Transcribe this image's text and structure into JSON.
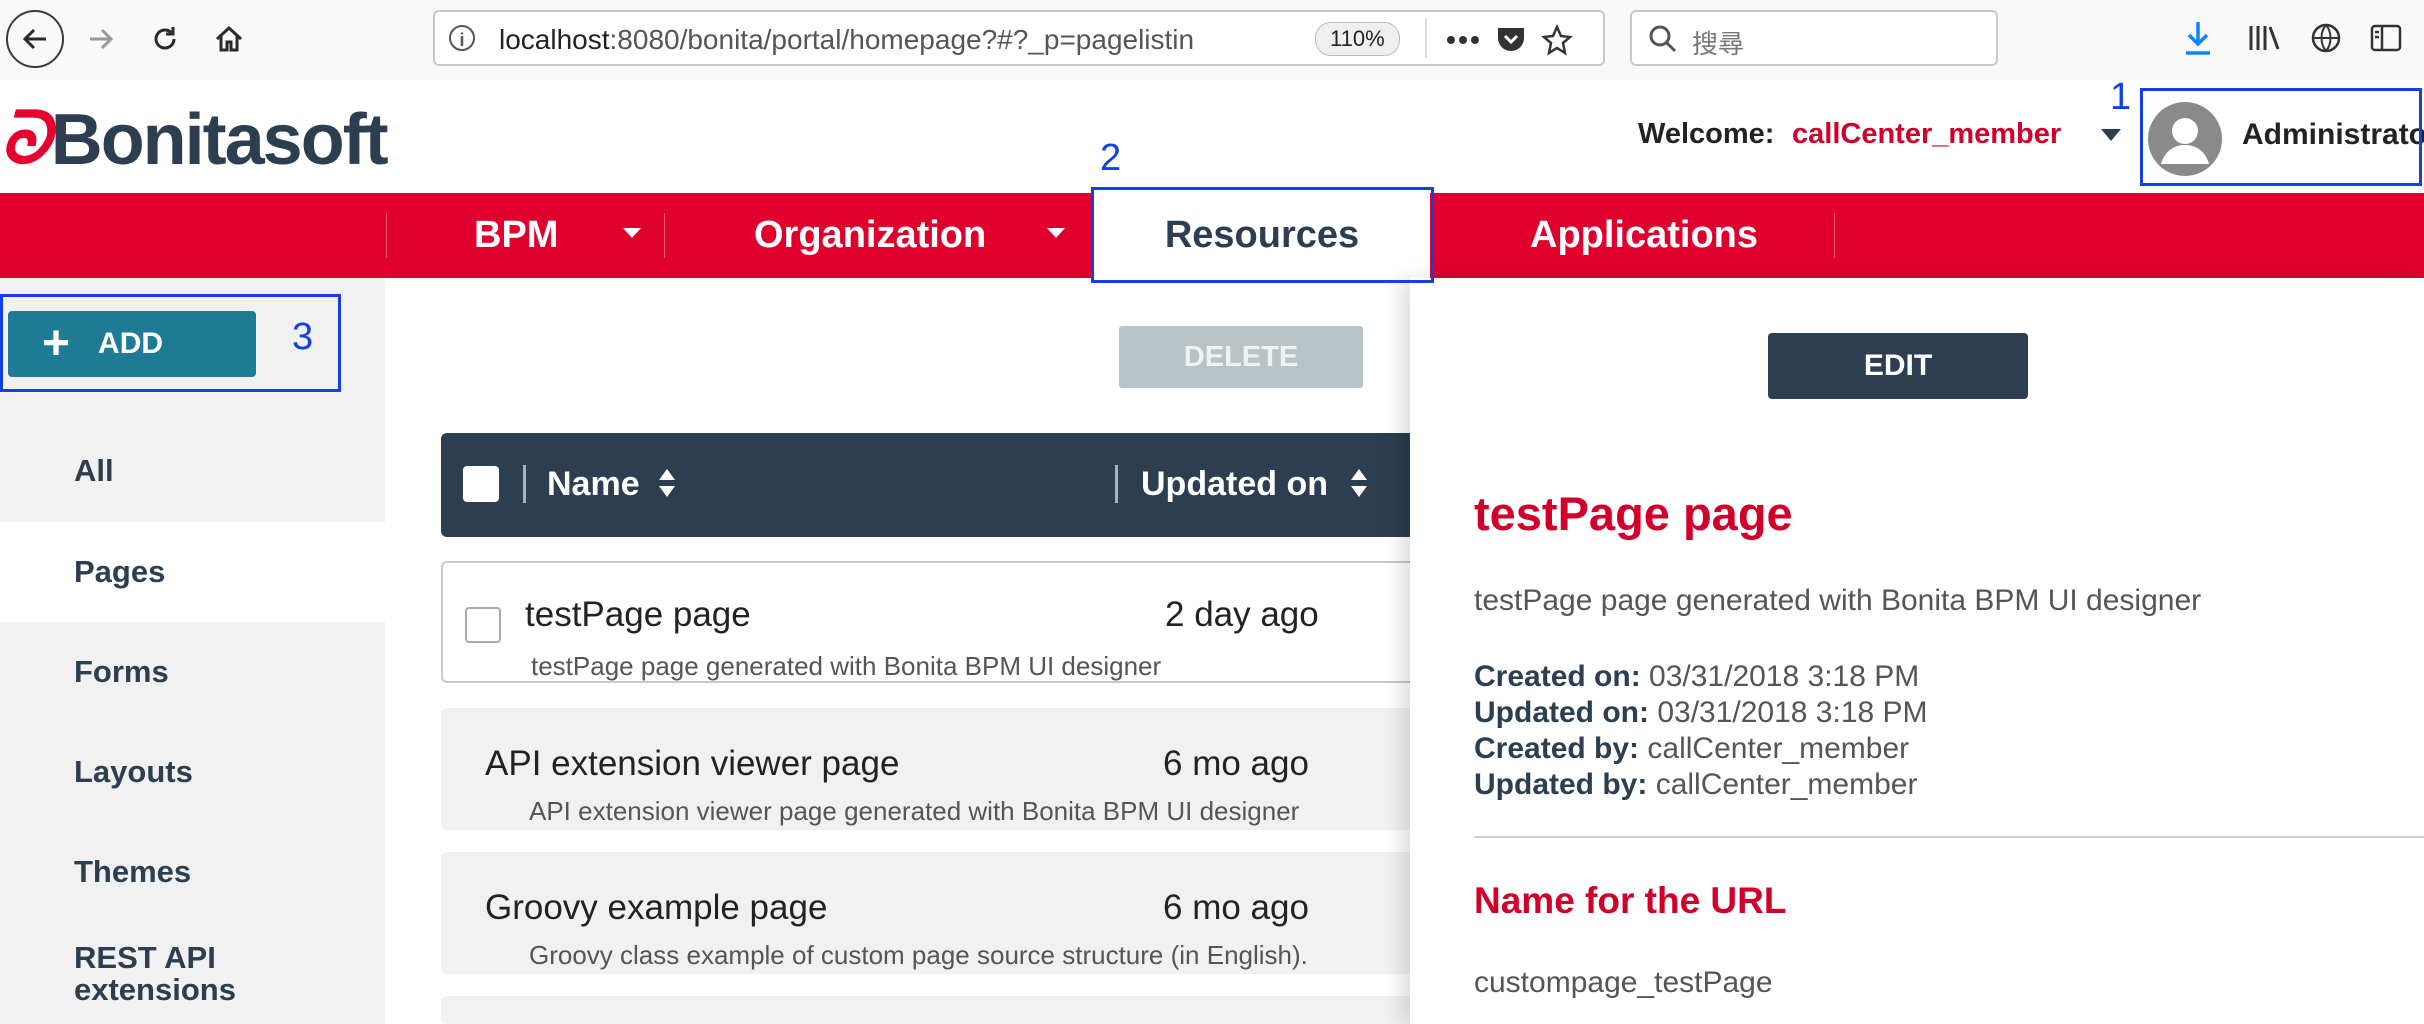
{
  "browser": {
    "url_host": "localhost",
    "url_rest": ":8080/bonita/portal/homepage?#?_p=pagelistin",
    "zoom": "110%",
    "search_placeholder": "搜尋"
  },
  "header": {
    "logo_text": "Bonitasoft",
    "welcome_label": "Welcome:",
    "welcome_user": "callCenter_member",
    "profile_label": "Administrato"
  },
  "nav": {
    "items": [
      {
        "label": "BPM"
      },
      {
        "label": "Organization"
      },
      {
        "label": "Resources"
      },
      {
        "label": "Applications"
      }
    ]
  },
  "sidebar": {
    "add_label": "ADD",
    "items": [
      {
        "label": "All"
      },
      {
        "label": "Pages"
      },
      {
        "label": "Forms"
      },
      {
        "label": "Layouts"
      },
      {
        "label": "Themes"
      },
      {
        "label": "REST API extensions"
      }
    ]
  },
  "list": {
    "delete_label": "DELETE",
    "col_name": "Name",
    "col_updated": "Updated on",
    "rows": [
      {
        "name": "testPage page",
        "updated": "2 day ago",
        "desc": "testPage page generated with Bonita BPM UI designer"
      },
      {
        "name": "API extension viewer page",
        "updated": "6 mo ago",
        "desc": "API extension viewer page generated with Bonita BPM UI designer"
      },
      {
        "name": "Groovy example page",
        "updated": "6 mo ago",
        "desc": "Groovy class example of custom page source structure (in English)."
      }
    ]
  },
  "detail": {
    "edit_label": "EDIT",
    "title": "testPage page",
    "description": "testPage page generated with Bonita BPM UI designer",
    "created_on_label": "Created on:",
    "created_on": "03/31/2018 3:18 PM",
    "updated_on_label": "Updated on:",
    "updated_on": "03/31/2018 3:18 PM",
    "created_by_label": "Created by:",
    "created_by": "callCenter_member",
    "updated_by_label": "Updated by:",
    "updated_by": "callCenter_member",
    "url_heading": "Name for the URL",
    "url_name": "custompage_testPage"
  },
  "annotations": [
    "1",
    "2",
    "3"
  ],
  "colors": {
    "brand_red": "#e0002d",
    "navy": "#2c3e50",
    "teal": "#1f7a95",
    "annotation_blue": "#1240e8"
  }
}
